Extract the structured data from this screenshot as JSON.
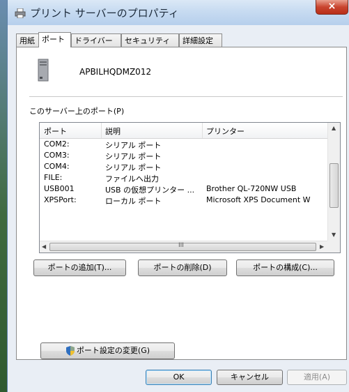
{
  "window": {
    "title": "プリント サーバーのプロパティ",
    "close_label": "×"
  },
  "tabs": [
    {
      "label": "用紙"
    },
    {
      "label": "ポート"
    },
    {
      "label": "ドライバー"
    },
    {
      "label": "セキュリティ"
    },
    {
      "label": "詳細設定"
    }
  ],
  "server": {
    "name": "APBILHQDMZ012"
  },
  "ports_section": {
    "label": "このサーバー上のポート(P)"
  },
  "table": {
    "columns": [
      "ポート",
      "説明",
      "プリンター"
    ],
    "rows": [
      {
        "port": "COM2:",
        "description": "シリアル ポート",
        "printer": ""
      },
      {
        "port": "COM3:",
        "description": "シリアル ポート",
        "printer": ""
      },
      {
        "port": "COM4:",
        "description": "シリアル ポート",
        "printer": ""
      },
      {
        "port": "FILE:",
        "description": "ファイルへ出力",
        "printer": ""
      },
      {
        "port": "USB001",
        "description": "USB の仮想プリンター ...",
        "printer": "Brother QL-720NW USB"
      },
      {
        "port": "XPSPort:",
        "description": "ローカル ポート",
        "printer": "Microsoft XPS Document W"
      }
    ],
    "hscroll_mid": "III"
  },
  "buttons": {
    "add_port": "ポートの追加(T)...",
    "delete_port": "ポートの削除(D)",
    "configure_port": "ポートの構成(C)...",
    "change_settings": "ポート設定の変更(G)",
    "ok": "OK",
    "cancel": "キャンセル",
    "apply": "適用(A)"
  },
  "colors": {
    "titlebar": "#c7dbf1",
    "close": "#c9452f",
    "dialog_bg": "#e9eef5"
  }
}
